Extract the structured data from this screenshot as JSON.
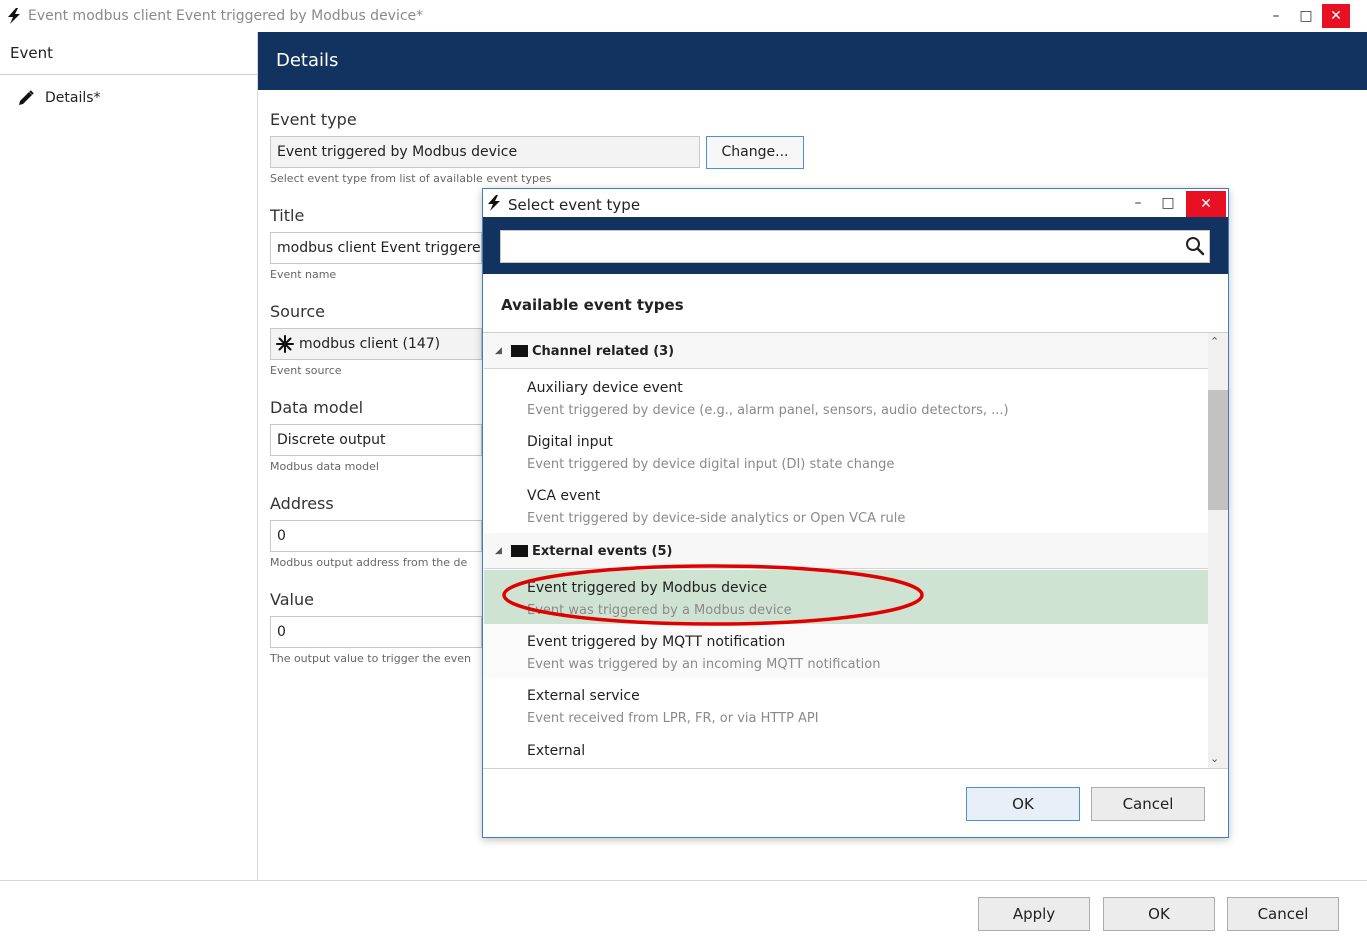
{
  "window": {
    "title": "Event modbus client Event triggered by Modbus device*",
    "minimize": "–",
    "maximize": "□",
    "close": "✕"
  },
  "sidebar": {
    "header": "Event",
    "items": [
      {
        "label": "Details*",
        "icon": "pencil-icon"
      }
    ]
  },
  "details": {
    "header": "Details",
    "event_type": {
      "label": "Event type",
      "value": "Event triggered by Modbus device",
      "change_label": "Change...",
      "hint": "Select event type from list of available event types"
    },
    "title": {
      "label": "Title",
      "value": "modbus client Event triggered",
      "hint": "Event name"
    },
    "source": {
      "label": "Source",
      "value": "modbus client (147)",
      "hint": "Event source"
    },
    "data_model": {
      "label": "Data model",
      "value": "Discrete output",
      "hint": "Modbus data model"
    },
    "address": {
      "label": "Address",
      "value": "0",
      "hint": "Modbus output address from the de"
    },
    "value": {
      "label": "Value",
      "value": "0",
      "hint": "The output value to trigger the even"
    }
  },
  "footer": {
    "apply": "Apply",
    "ok": "OK",
    "cancel": "Cancel"
  },
  "dialog": {
    "title": "Select event type",
    "minimize": "–",
    "maximize": "□",
    "close": "✕",
    "search_value": "",
    "heading": "Available event types",
    "groups": [
      {
        "label": "Channel related (3)",
        "items": [
          {
            "title": "Auxiliary device event",
            "desc": "Event triggered by device (e.g., alarm panel, sensors, audio detectors, ...)"
          },
          {
            "title": "Digital input",
            "desc": "Event triggered by device digital input (DI) state change"
          },
          {
            "title": "VCA event",
            "desc": "Event triggered by device-side analytics or Open VCA rule"
          }
        ]
      },
      {
        "label": "External events (5)",
        "items": [
          {
            "title": "Event triggered by Modbus device",
            "desc": "Event was triggered by a Modbus device",
            "selected": true
          },
          {
            "title": "Event triggered by MQTT notification",
            "desc": "Event was triggered by an incoming MQTT notification"
          },
          {
            "title": "External service",
            "desc": "Event received from LPR, FR, or via HTTP API"
          },
          {
            "title": "External",
            "desc": ""
          }
        ]
      }
    ],
    "ok": "OK",
    "cancel": "Cancel"
  },
  "colors": {
    "header_bg": "#12325f",
    "selected_row": "#cfe3d2",
    "annotation": "#e00000",
    "close_red": "#e81123"
  }
}
